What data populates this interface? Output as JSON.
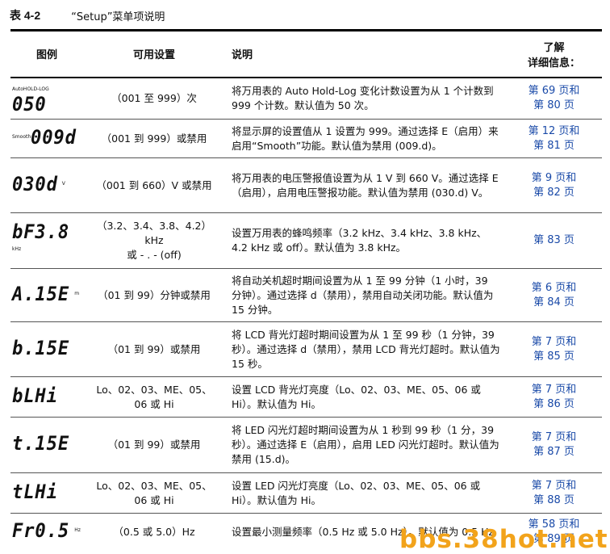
{
  "caption": {
    "number": "表 4-2",
    "title": "“Setup”菜单项说明"
  },
  "headers": {
    "icon": "图例",
    "setting": "可用设置",
    "desc": "说明",
    "ref1": "了解",
    "ref2": "详细信息："
  },
  "rows": [
    {
      "lcd": "050",
      "tag": "AutoHOLD-LOG",
      "setting": "（001 至 999）次",
      "desc": "将万用表的 Auto Hold-Log 变化计数设置为从 1 个计数到 999 个计数。默认值为 50 次。",
      "ref1": "第 69 页和",
      "ref2": "第 80 页"
    },
    {
      "lcd": "009d",
      "tag": "Smooth",
      "setting": "（001 到 999）或禁用",
      "desc": "将显示屏的设置值从 1 设置为 999。通过选择 E（启用）来启用“Smooth”功能。默认值为禁用 (009.d)。",
      "ref1": "第 12 页和",
      "ref2": "第 81 页"
    },
    {
      "lcd": "030d",
      "tag": "V",
      "setting": "（001 到 660）V 或禁用",
      "desc": "将万用表的电压警报值设置为从 1 V 到 660 V。通过选择 E（启用），启用电压警报功能。默认值为禁用 (030.d) V。",
      "ref1": "第 9 页和",
      "ref2": "第 82 页"
    },
    {
      "lcd": "bF3.8",
      "tag": "kHz",
      "setting1": "（3.2、3.4、3.8、4.2）",
      "setting2": "kHz",
      "setting3": "或 - . - (off)",
      "desc": "设置万用表的蜂鸣频率（3.2 kHz、3.4 kHz、3.8 kHz、4.2 kHz 或 off）。默认值为 3.8 kHz。",
      "ref1": "第 83 页",
      "ref2": ""
    },
    {
      "lcd": "A.15E",
      "tag": "m",
      "setting": "（01 到 99）分钟或禁用",
      "desc": "将自动关机超时期间设置为从 1 至 99 分钟（1 小时，39 分钟）。通过选择 d（禁用），禁用自动关闭功能。默认值为 15 分钟。",
      "ref1": "第 6 页和",
      "ref2": "第 84 页"
    },
    {
      "lcd": "b.15E",
      "tag": "",
      "setting": "（01 到 99）或禁用",
      "desc": "将 LCD 背光灯超时期间设置为从 1 至 99 秒（1 分钟，39 秒）。通过选择 d（禁用），禁用 LCD 背光灯超时。默认值为 15 秒。",
      "ref1": "第 7 页和",
      "ref2": "第 85 页"
    },
    {
      "lcd": "bLHi",
      "tag": "",
      "setting1": "Lo、02、03、ME、05、",
      "setting2": "06 或 Hi",
      "desc": "设置 LCD 背光灯亮度（Lo、02、03、ME、05、06 或 Hi）。默认值为 Hi。",
      "ref1": "第 7 页和",
      "ref2": "第 86 页"
    },
    {
      "lcd": "t.15E",
      "tag": "",
      "setting": "（01 到 99）或禁用",
      "desc": "将 LED 闪光灯超时期间设置为从 1 秒到 99 秒（1 分，39 秒）。通过选择 E（启用），启用 LED 闪光灯超时。默认值为禁用 (15.d)。",
      "ref1": "第 7 页和",
      "ref2": "第 87 页"
    },
    {
      "lcd": "tLHi",
      "tag": "",
      "setting1": "Lo、02、03、ME、05、",
      "setting2": "06 或 Hi",
      "desc": "设置 LED 闪光灯亮度（Lo、02、03、ME、05、06 或 Hi）。默认值为 Hi。",
      "ref1": "第 7 页和",
      "ref2": "第 88 页"
    },
    {
      "lcd": "Fr0.5",
      "tag": "Hz",
      "setting": "（0.5 或 5.0）Hz",
      "desc": "设置最小测量频率（0.5 Hz 或 5.0 Hz）。默认值为 0.5 Hz",
      "ref1": "第 58 页和",
      "ref2": "第 89 页"
    }
  ],
  "watermark": "bbs.38hot.net"
}
